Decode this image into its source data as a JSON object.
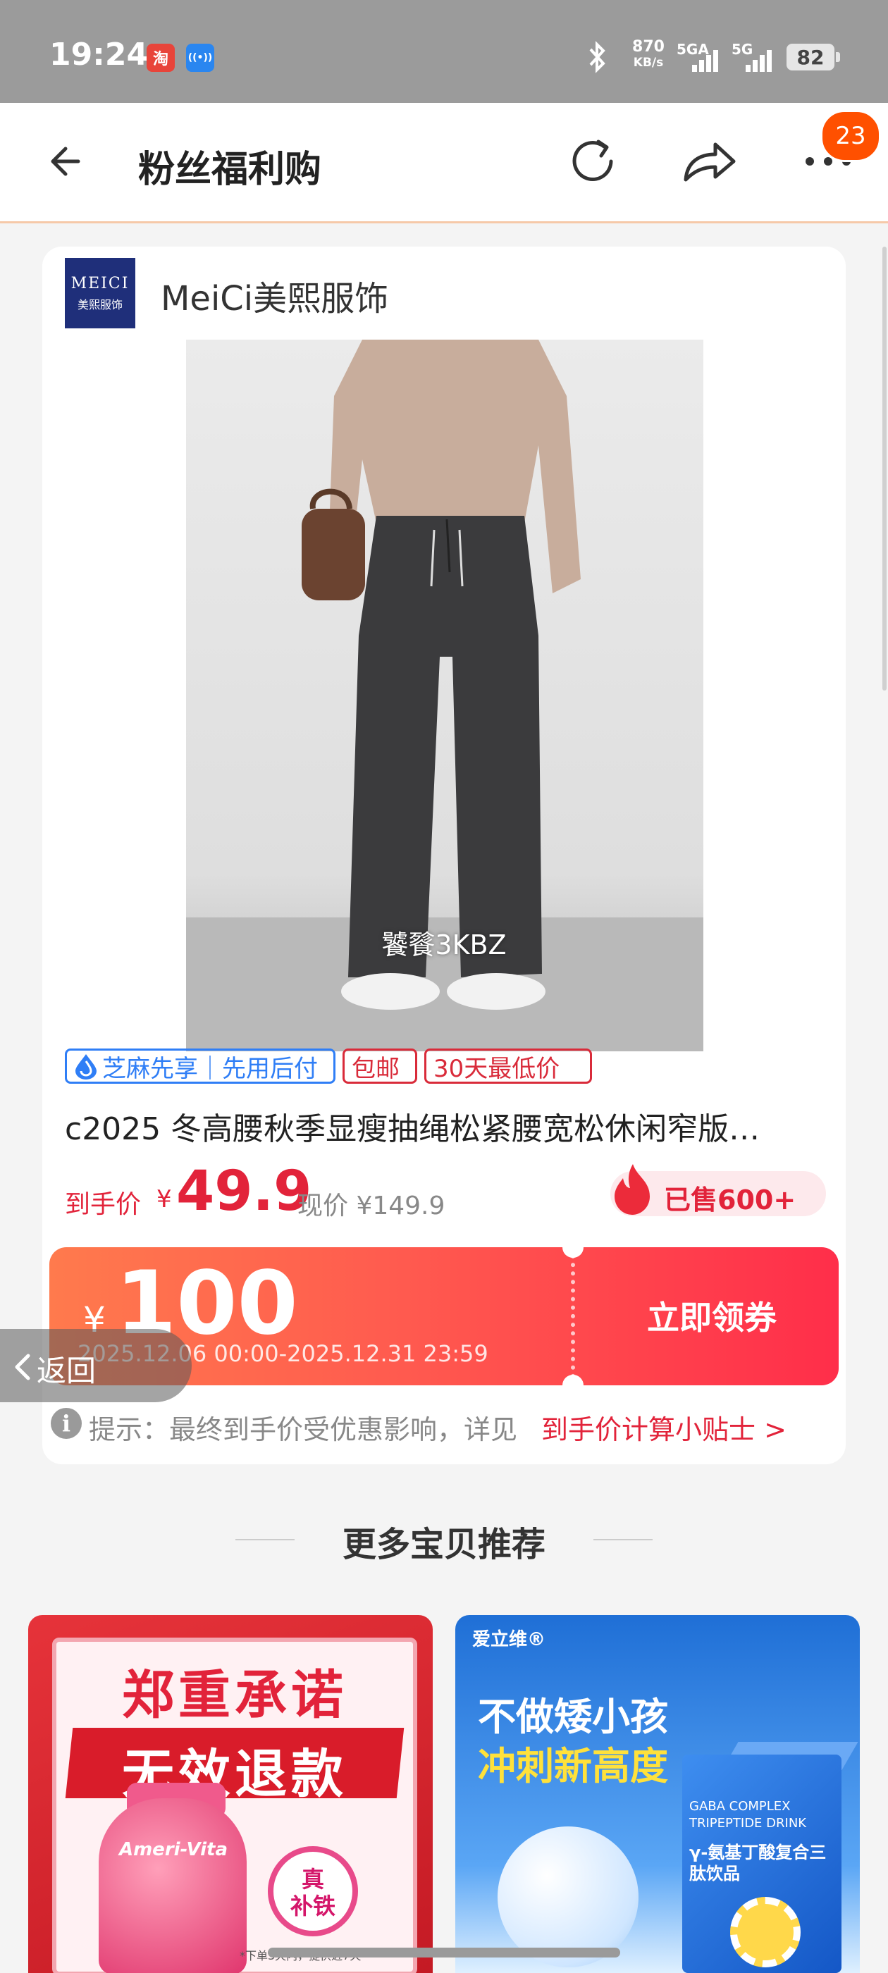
{
  "status_bar": {
    "time": "19:24",
    "app_icon_1_text": "淘",
    "app_icon_2_text": "((•))",
    "net_speed_value": "870",
    "net_speed_unit": "KB/s",
    "signal_1_label": "5GA",
    "signal_2_label": "5G",
    "battery": "82",
    "icons": [
      "taobao-app-icon",
      "hotspot-app-icon",
      "bluetooth-icon",
      "signal-icon",
      "battery-icon"
    ]
  },
  "nav": {
    "title": "粉丝福利购",
    "badge_count": "23",
    "icons": [
      "back-arrow-icon",
      "refresh-icon",
      "share-icon",
      "more-icon"
    ]
  },
  "shop": {
    "name": "MeiCi美熙服饰",
    "logo_line1": "MEICI",
    "logo_line2": "美熙服饰"
  },
  "product": {
    "image_code": "饕餮3KBZ",
    "tags": [
      "芝麻先享｜先用后付",
      "包邮",
      "30天最低价"
    ],
    "title": "c2025 冬高腰秋季显瘦抽绳松紧腰宽松休闲窄版…",
    "price_label": "到手价",
    "price_currency": "¥",
    "price_value": "49.9",
    "original_price": "现价 ¥149.9",
    "sold": "已售600+"
  },
  "coupon": {
    "currency": "¥",
    "amount": "100",
    "valid_period": "2025.12.06 00:00-2025.12.31 23:59",
    "button_label": "立即领券"
  },
  "tip": {
    "icon_text": "i",
    "text": "提示：最终到手价受优惠影响，详见",
    "link": "到手价计算小贴士 >"
  },
  "back_float": {
    "label": "返回"
  },
  "recommend": {
    "title": "更多宝贝推荐",
    "items": [
      {
        "line1": "郑重承诺",
        "line2": "无效退款",
        "bottle_label": "Ameri-Vita",
        "seal_text": "真\n补铁",
        "note": "*下单3天内，提供近7天"
      },
      {
        "brand": "爱立维®",
        "line1": "不做矮小孩",
        "line2": "冲刺新高度",
        "box_en": "GABA COMPLEX TRIPEPTIDE DRINK",
        "box_cn": "γ-氨基丁酸复合三肽饮品"
      }
    ]
  },
  "colors": {
    "accent": "#ff5000",
    "price_red": "#e2233a",
    "coupon_start": "#ff7a4d",
    "coupon_end": "#ff2e4a"
  }
}
